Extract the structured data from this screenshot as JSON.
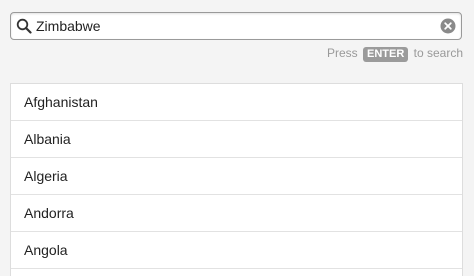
{
  "search": {
    "value": "Zimbabwe",
    "search_icon": "search-icon",
    "clear_icon": "clear-circle-x-icon"
  },
  "hint": {
    "prefix": "Press",
    "key": "ENTER",
    "suffix": "to search"
  },
  "results": {
    "items": [
      {
        "label": "Afghanistan"
      },
      {
        "label": "Albania"
      },
      {
        "label": "Algeria"
      },
      {
        "label": "Andorra"
      },
      {
        "label": "Angola"
      }
    ]
  },
  "colors": {
    "background": "#f4f4f4",
    "badge": "#9b9b9b",
    "hint_text": "#999999"
  }
}
